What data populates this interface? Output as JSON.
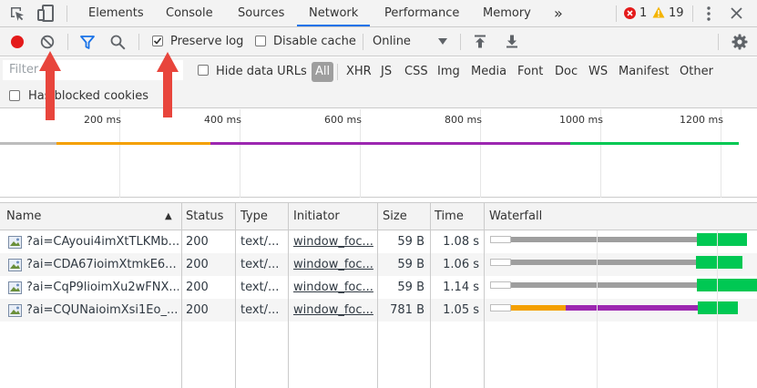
{
  "tabs": {
    "elements": "Elements",
    "console": "Console",
    "sources": "Sources",
    "network": "Network",
    "performance": "Performance",
    "memory": "Memory",
    "overflow": "»",
    "errors_count": "1",
    "warnings_count": "19"
  },
  "toolbar": {
    "preserve_log": "Preserve log",
    "preserve_log_checked": true,
    "disable_cache": "Disable cache",
    "disable_cache_checked": false,
    "throttling": "Online"
  },
  "filterbar": {
    "filter_placeholder": "Filter",
    "hide_data_urls": "Hide data URLs",
    "types": [
      "All",
      "XHR",
      "JS",
      "CSS",
      "Img",
      "Media",
      "Font",
      "Doc",
      "WS",
      "Manifest",
      "Other"
    ],
    "active_type": "All",
    "has_blocked_cookies": "Has blocked cookies"
  },
  "overview": {
    "tick_labels": [
      "200 ms",
      "400 ms",
      "600 ms",
      "800 ms",
      "1000 ms",
      "1200 ms"
    ]
  },
  "table": {
    "headers": {
      "name": "Name",
      "status": "Status",
      "type": "Type",
      "initiator": "Initiator",
      "size": "Size",
      "time": "Time",
      "waterfall": "Waterfall"
    },
    "sort_indicator": "▲",
    "rows": [
      {
        "name": "?ai=CAyoui4imXtTLKMb...",
        "status": "200",
        "type": "text/...",
        "initiator": "window_foc...",
        "size": "59 B",
        "time": "1.08 s"
      },
      {
        "name": "?ai=CDA67ioimXtmkE6...",
        "status": "200",
        "type": "text/...",
        "initiator": "window_foc...",
        "size": "59 B",
        "time": "1.06 s"
      },
      {
        "name": "?ai=CqP9lioimXu2wFNX...",
        "status": "200",
        "type": "text/...",
        "initiator": "window_foc...",
        "size": "59 B",
        "time": "1.14 s"
      },
      {
        "name": "?ai=CQUNaioimXsi1Eo_...",
        "status": "200",
        "type": "text/...",
        "initiator": "window_foc...",
        "size": "781 B",
        "time": "1.05 s"
      }
    ]
  },
  "colors": {
    "record": "#e41b1b",
    "accent": "#1a73e8",
    "waiting": "#9e9e9e",
    "download": "#00c853",
    "dns": "#f4a000",
    "ssl": "#9c27b0",
    "annotation_arrow": "#e8453c"
  }
}
